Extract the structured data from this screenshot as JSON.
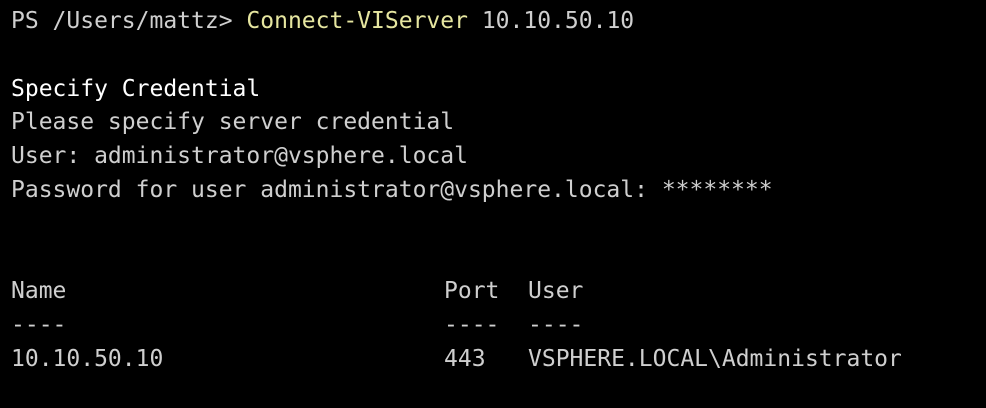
{
  "terminal": {
    "prompt": "PS /Users/mattz> ",
    "command": "Connect-VIServer",
    "argument": " 10.10.50.10",
    "credential_heading": "Specify Credential",
    "credential_message": "Please specify server credential",
    "user_line": "User: administrator@vsphere.local",
    "password_line": "Password for user administrator@vsphere.local: ********"
  },
  "table": {
    "headers": [
      "Name",
      "Port",
      "User"
    ],
    "separators": [
      "----",
      "----",
      "----"
    ],
    "rows": [
      [
        "10.10.50.10",
        "443",
        "VSPHERE.LOCAL\\Administrator"
      ]
    ]
  },
  "colors": {
    "background": "#000000",
    "text": "#cfcfcf",
    "command": "#e6e6a0"
  }
}
